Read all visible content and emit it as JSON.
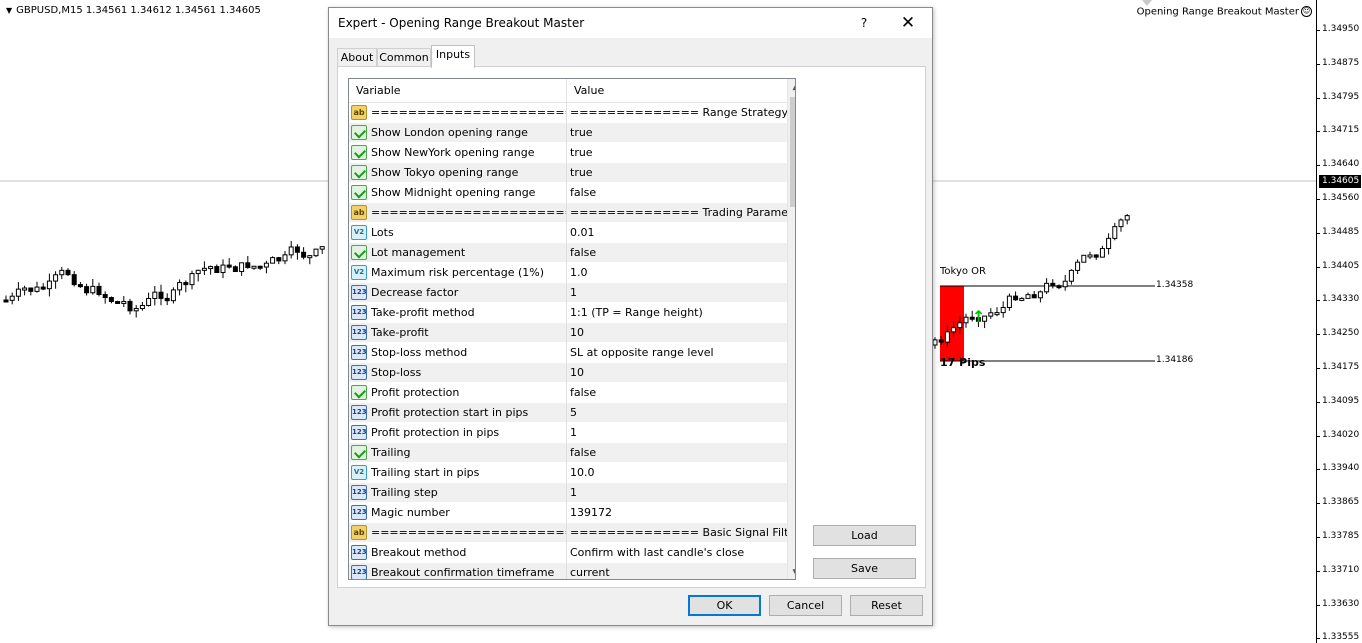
{
  "chart": {
    "header": "GBPUSD,M15  1.34561 1.34612 1.34561 1.34605",
    "ea_name": "Opening Range Breakout Master",
    "smiley": "☺",
    "current_price": "1.34605",
    "price_labels": [
      "1.34950",
      "1.34875",
      "1.34795",
      "1.34715",
      "1.34640",
      "1.34560",
      "1.34485",
      "1.34405",
      "1.34330",
      "1.34250",
      "1.34175",
      "1.34095",
      "1.34020",
      "1.33940",
      "1.33865",
      "1.33785",
      "1.33710",
      "1.33630",
      "1.33555"
    ],
    "range_label": "Tokyo OR",
    "range_high": "1.34358",
    "range_low": "1.34186",
    "range_pips": "17 Pips",
    "range_color": "#ff0000",
    "signal_color": "#00c000",
    "signal_arrow": "↑"
  },
  "dialog": {
    "title": "Expert - Opening Range Breakout Master",
    "help": "?",
    "close": "✕",
    "tabs": [
      "About",
      "Common",
      "Inputs"
    ],
    "active_tab": "Inputs",
    "columns": [
      "Variable",
      "Value"
    ],
    "rows": [
      {
        "icon": "ab",
        "variable": "================================",
        "value": "============== Range Strategy Settings..."
      },
      {
        "icon": "bool",
        "variable": "Show London opening range",
        "value": "true"
      },
      {
        "icon": "bool",
        "variable": "Show NewYork opening range",
        "value": "true"
      },
      {
        "icon": "bool",
        "variable": "Show Tokyo opening range",
        "value": "true"
      },
      {
        "icon": "bool",
        "variable": "Show Midnight opening range",
        "value": "false"
      },
      {
        "icon": "ab",
        "variable": "================================",
        "value": "============== Trading Parameters ===..."
      },
      {
        "icon": "dbl",
        "variable": "Lots",
        "value": "0.01"
      },
      {
        "icon": "bool",
        "variable": "Lot management",
        "value": "false"
      },
      {
        "icon": "dbl",
        "variable": "Maximum risk percentage (1%)",
        "value": "1.0"
      },
      {
        "icon": "int",
        "variable": "Decrease factor",
        "value": "1"
      },
      {
        "icon": "int",
        "variable": "Take-profit method",
        "value": "1:1 (TP = Range height)"
      },
      {
        "icon": "int",
        "variable": "Take-profit",
        "value": "10"
      },
      {
        "icon": "int",
        "variable": "Stop-loss method",
        "value": "SL at opposite range level"
      },
      {
        "icon": "int",
        "variable": "Stop-loss",
        "value": "10"
      },
      {
        "icon": "bool",
        "variable": "Profit protection",
        "value": "false"
      },
      {
        "icon": "int",
        "variable": "Profit protection start in pips",
        "value": "5"
      },
      {
        "icon": "int",
        "variable": "Profit protection in pips",
        "value": "1"
      },
      {
        "icon": "bool",
        "variable": "Trailing",
        "value": "false"
      },
      {
        "icon": "dbl",
        "variable": "Trailing start in pips",
        "value": "10.0"
      },
      {
        "icon": "int",
        "variable": "Trailing step",
        "value": "1"
      },
      {
        "icon": "int",
        "variable": "Magic number",
        "value": "139172"
      },
      {
        "icon": "ab",
        "variable": "================================",
        "value": "============== Basic Signal Filters ====..."
      },
      {
        "icon": "int",
        "variable": "Breakout method",
        "value": "Confirm with last candle's close"
      },
      {
        "icon": "int",
        "variable": "Breakout confirmation timeframe",
        "value": "current"
      }
    ],
    "buttons": {
      "load": "Load",
      "save": "Save",
      "ok": "OK",
      "cancel": "Cancel",
      "reset": "Reset"
    }
  }
}
